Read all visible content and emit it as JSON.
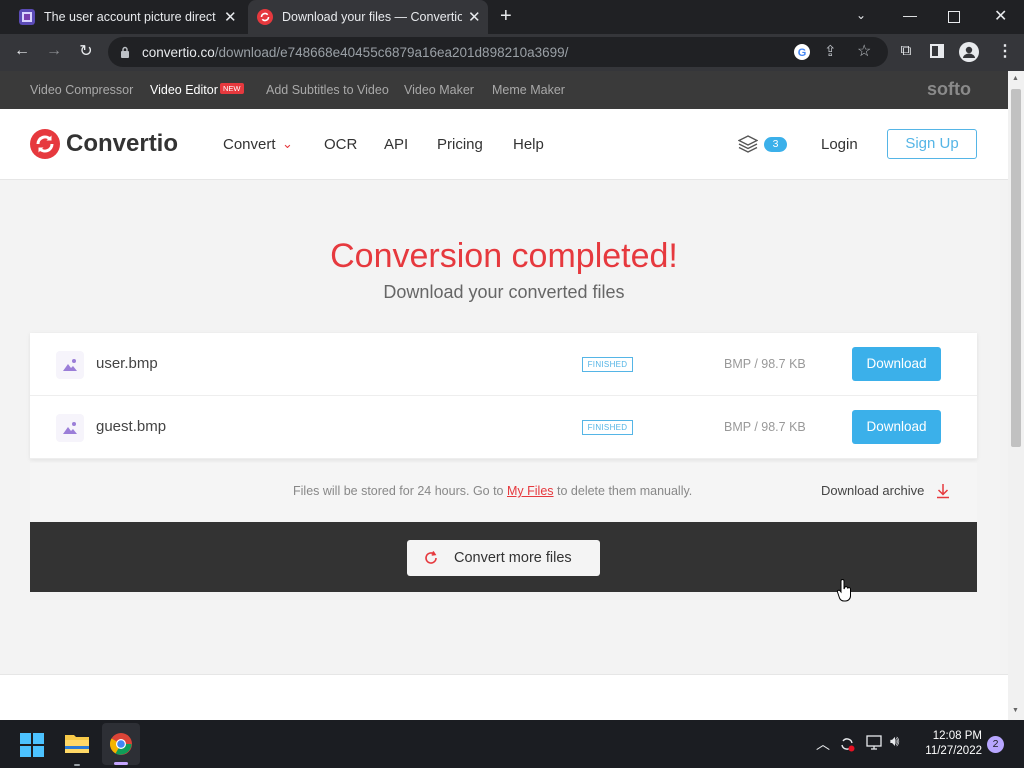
{
  "browser": {
    "tabs": [
      {
        "title": "The user account picture director"
      },
      {
        "title": "Download your files — Convertio"
      }
    ],
    "url_host": "convertio.co",
    "url_path": "/download/e748668e40455c6879a16ea201d898210a3699/"
  },
  "promo_bar": {
    "items": [
      "Video Compressor",
      "Video Editor",
      "Add Subtitles to Video",
      "Video Maker",
      "Meme Maker"
    ],
    "new_badge": "NEW",
    "brand": "softo"
  },
  "header": {
    "logo": "Convertio",
    "nav": [
      "Convert",
      "OCR",
      "API",
      "Pricing",
      "Help"
    ],
    "layers_count": "3",
    "login": "Login",
    "signup": "Sign Up"
  },
  "hero": {
    "title": "Conversion completed!",
    "subtitle": "Download your converted files"
  },
  "files": [
    {
      "name": "user.bmp",
      "status": "FINISHED",
      "meta": "BMP / 98.7 KB",
      "action": "Download"
    },
    {
      "name": "guest.bmp",
      "status": "FINISHED",
      "meta": "BMP / 98.7 KB",
      "action": "Download"
    }
  ],
  "storage_note": {
    "before": "Files will be stored for 24 hours. Go to",
    "link": "My Files",
    "after": "to delete them manually.",
    "archive": "Download archive"
  },
  "convert_more": "Convert more files",
  "taskbar": {
    "time": "12:08 PM",
    "date": "11/27/2022",
    "notifications": "2"
  },
  "colors": {
    "accent_red": "#e6393e",
    "download_blue": "#3bb0ea",
    "signup_blue": "#55b5e6"
  }
}
